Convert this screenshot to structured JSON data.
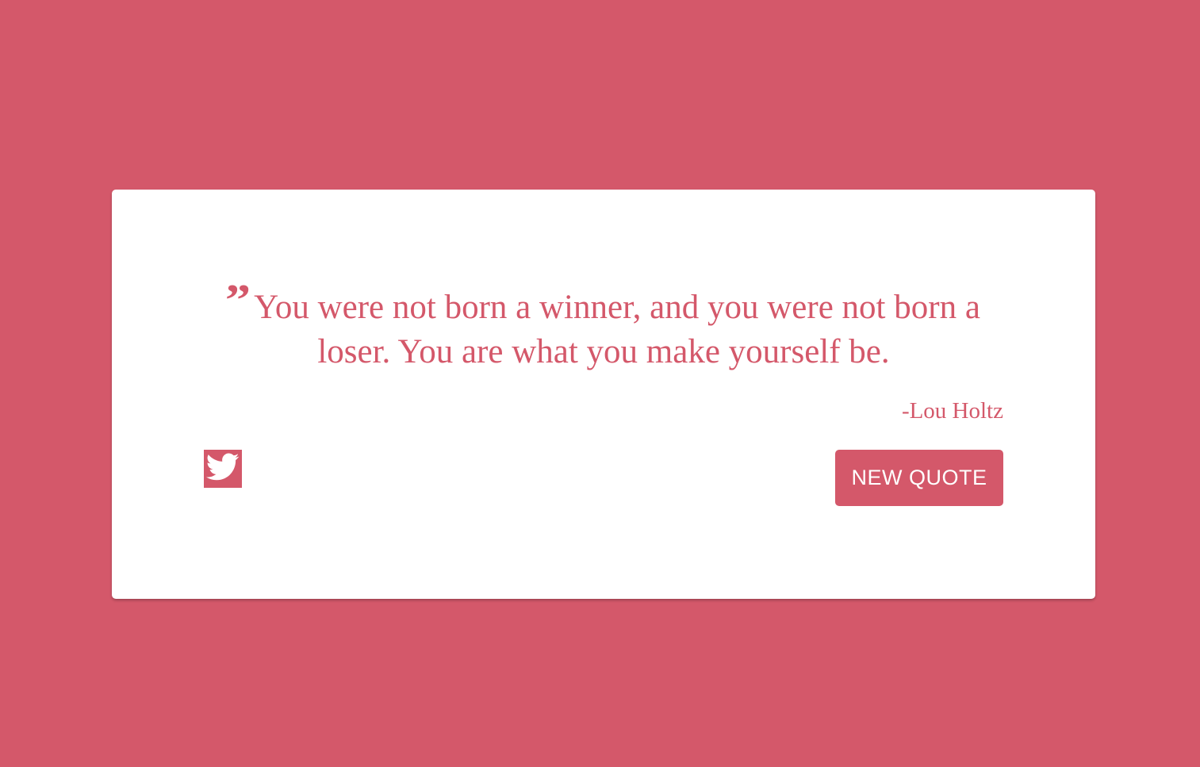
{
  "colors": {
    "background": "#d4586a",
    "card": "#ffffff",
    "accent": "#d4586a",
    "button_text": "#ffffff"
  },
  "quote": {
    "icon": "quote-icon",
    "text": "You were not born a winner, and you were not born a loser. You are what you make yourself be.",
    "author": "-Lou Holtz"
  },
  "actions": {
    "tweet_icon": "twitter-icon",
    "new_quote_label": "NEW QUOTE"
  }
}
